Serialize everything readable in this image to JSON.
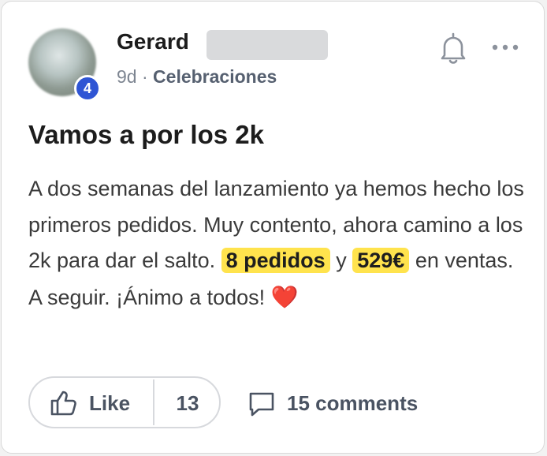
{
  "post": {
    "author_name": "Gerard",
    "avatar_badge": "4",
    "time_ago": "9d",
    "separator": "·",
    "category": "Celebraciones",
    "title": "Vamos a por los 2k",
    "body_part1": "A dos semanas del lanzamiento ya hemos hecho los primeros pedidos. Muy contento, ahora camino a los 2k para dar el salto.",
    "highlight_orders": "8 pedidos",
    "body_part2": "y",
    "highlight_sales": "529€",
    "body_part3": "en ventas. A seguir. ¡Ánimo a todos!",
    "emoji": "❤️"
  },
  "actions": {
    "like_label": "Like",
    "like_count": "13",
    "comments_label": "15 comments"
  },
  "icons": {
    "notification": "bell-icon",
    "menu": "more-options-icon",
    "like": "thumbs-up-icon",
    "comment": "comment-bubble-icon"
  },
  "colors": {
    "highlight": "#ffe34d",
    "badge": "#2f55d4",
    "heart": "#e0192a"
  }
}
